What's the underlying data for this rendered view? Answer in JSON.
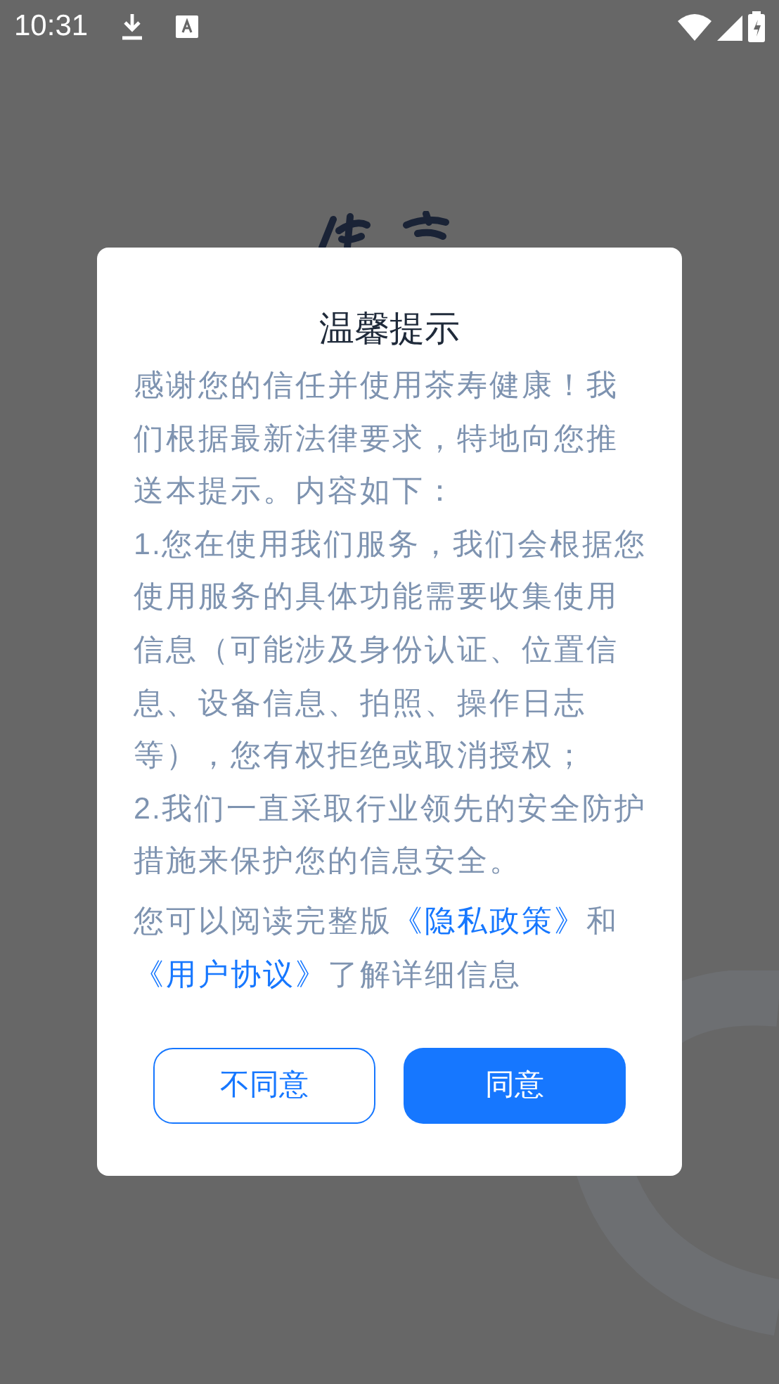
{
  "status_bar": {
    "time": "10:31"
  },
  "dialog": {
    "title": "温馨提示",
    "body": "感谢您的信任并使用茶寿健康！我们根据最新法律要求，特地向您推送本提示。内容如下：\n1.您在使用我们服务，我们会根据您使用服务的具体功能需要收集使用信息（可能涉及身份认证、位置信息、设备信息、拍照、操作日志等），您有权拒绝或取消授权；\n2.我们一直采取行业领先的安全防护措施来保护您的信息安全。",
    "links_text": [
      {
        "kind": "text",
        "text": "您可以阅读完整版"
      },
      {
        "kind": "link",
        "text": "《隐私政策》"
      },
      {
        "kind": "text",
        "text": "和"
      },
      {
        "kind": "link",
        "text": "《用户协议》"
      },
      {
        "kind": "text",
        "text": "了解详细信息"
      }
    ],
    "buttons": [
      {
        "label": "不同意",
        "kind": "outline"
      },
      {
        "label": "同意",
        "kind": "primary"
      }
    ]
  }
}
